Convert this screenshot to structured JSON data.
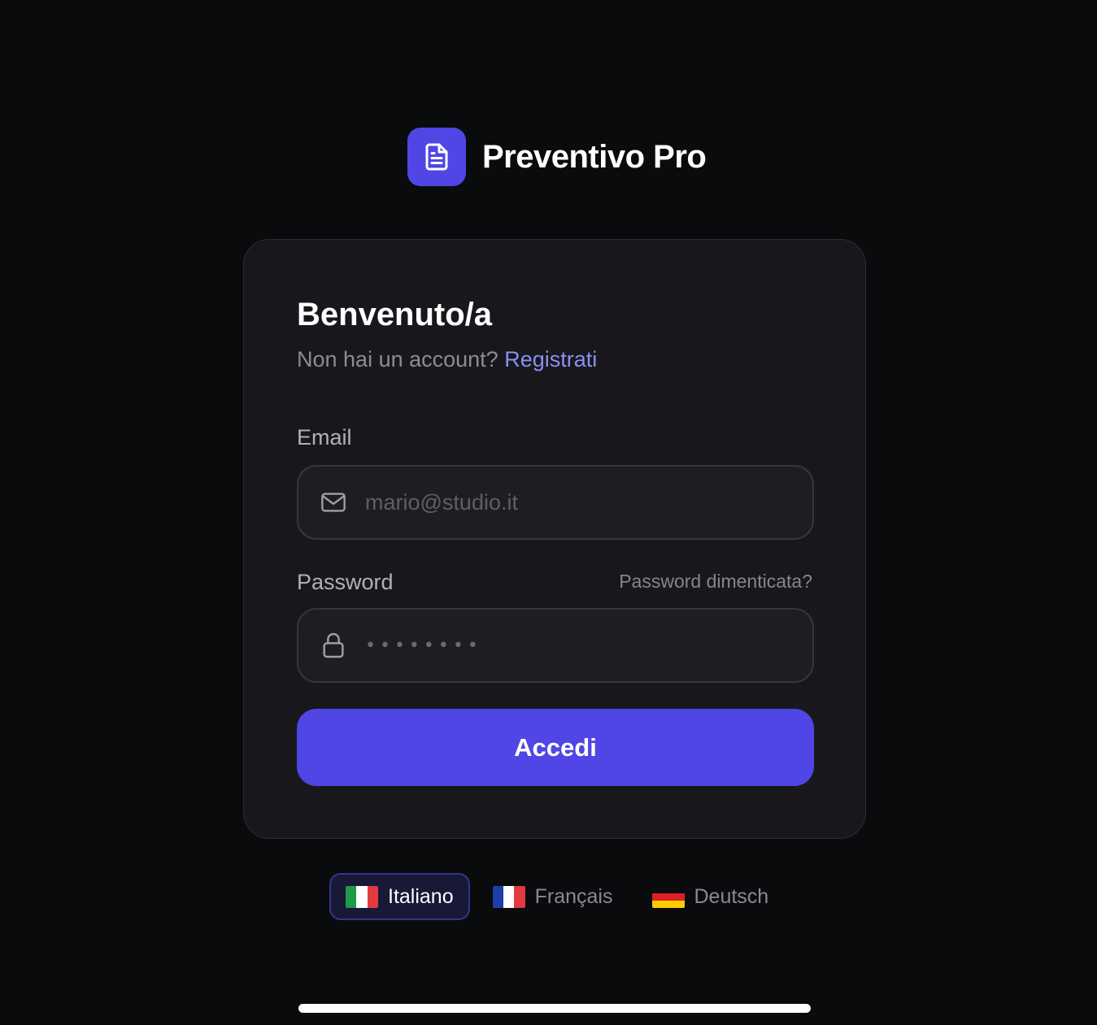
{
  "app": {
    "name": "Preventivo Pro",
    "logo_icon": "document-icon",
    "accent_color": "#4f46e5"
  },
  "login": {
    "title": "Benvenuto/a",
    "no_account_text": "Non hai un account?",
    "register_link": "Registrati",
    "email_label": "Email",
    "email_placeholder": "mario@studio.it",
    "email_icon": "mail-icon",
    "password_label": "Password",
    "forgot_link": "Password dimenticata?",
    "password_mask": "••••••••",
    "password_icon": "lock-icon",
    "submit_label": "Accedi"
  },
  "languages": [
    {
      "label": "Italiano",
      "flag": "italy-flag-icon",
      "active": true
    },
    {
      "label": "Français",
      "flag": "france-flag-icon",
      "active": false
    },
    {
      "label": "Deutsch",
      "flag": "germany-flag-icon",
      "active": false
    }
  ]
}
